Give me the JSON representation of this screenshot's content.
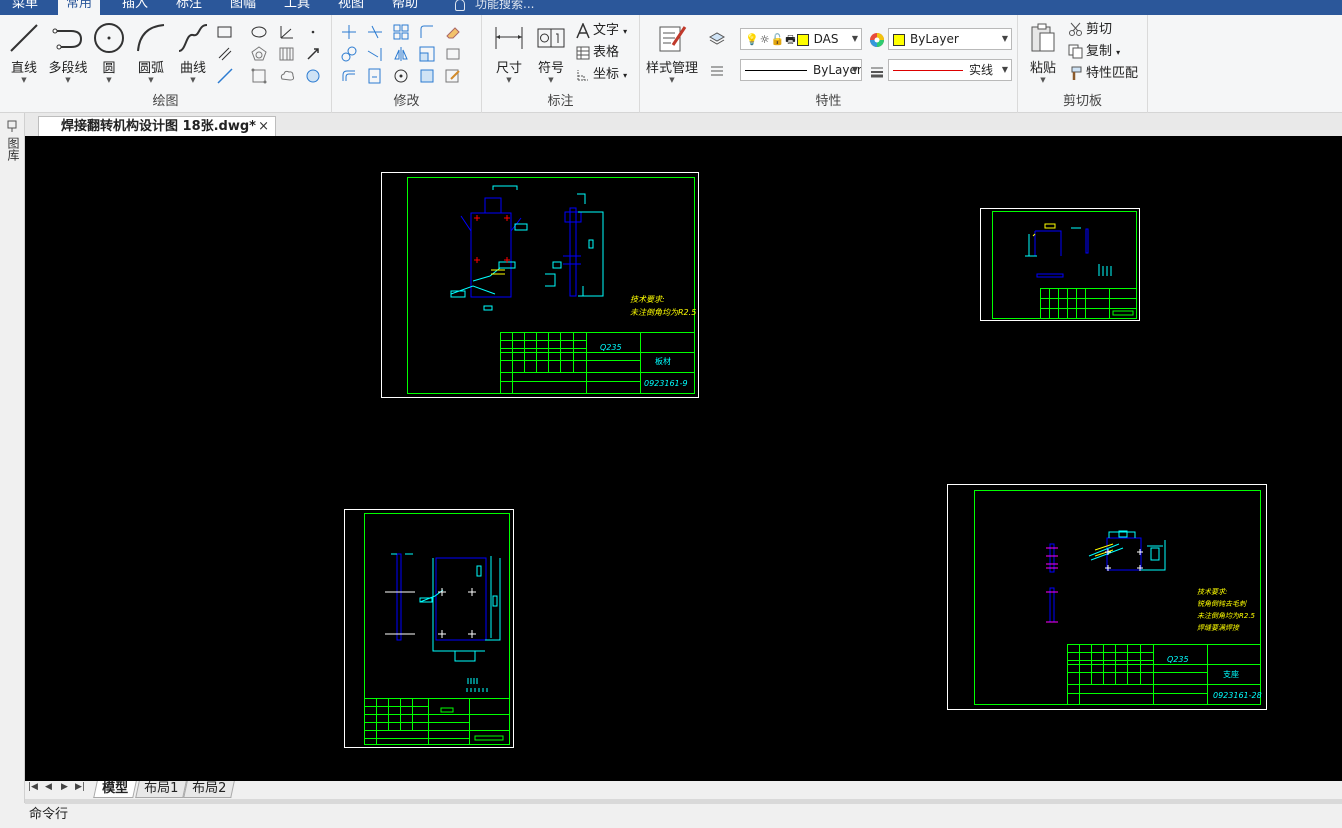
{
  "menu": {
    "tabs": [
      "菜单",
      "常用",
      "插入",
      "标注",
      "图幅",
      "工具",
      "视图",
      "帮助"
    ],
    "active": "常用",
    "search_placeholder": "功能搜索..."
  },
  "ribbon": {
    "draw": {
      "label": "绘图",
      "line": "直线",
      "polyline": "多段线",
      "circle": "圆",
      "arc": "圆弧",
      "curve": "曲线"
    },
    "modify": {
      "label": "修改"
    },
    "annotate": {
      "label": "标注",
      "dimension": "尺寸",
      "symbol": "符号",
      "text": "文字",
      "table": "表格",
      "coordinate": "坐标"
    },
    "properties": {
      "label": "特性",
      "style_manager": "样式管理",
      "layer_name": "DAS",
      "color_value": "ByLayer",
      "linetype_value": "ByLayer",
      "lineweight_value": "实线"
    },
    "clipboard": {
      "label": "剪切板",
      "paste": "粘贴",
      "cut": "剪切",
      "copy": "复制",
      "match_properties": "特性匹配"
    }
  },
  "document": {
    "tab_title": "焊接翻转机构设计图 18张.dwg*",
    "close_glyph": "×",
    "side_panel_label": "图库"
  },
  "drawings": [
    {
      "material": "Q235",
      "name_cell": "板材",
      "drawing_no": "0923161-9",
      "notes": [
        "技术要求:",
        "未注倒角均为R2.5"
      ]
    },
    {
      "material": "Q235",
      "name_cell": "支座",
      "drawing_no": "0923161-28",
      "notes": [
        "技术要求:",
        "锐角倒钝去毛刺",
        "未注倒角均为R2.5",
        "焊缝要满焊接"
      ]
    }
  ],
  "layout_tabs": [
    "模型",
    "布局1",
    "布局2"
  ],
  "active_layout": "模型",
  "command_line": {
    "label": "命令行"
  },
  "colors": {
    "accent": "#2b579a",
    "canvas": "#000000",
    "frame": "#00ff00",
    "geometry": "#0000ff",
    "dimension": "#00ffff",
    "highlight": "#ff00ff"
  }
}
